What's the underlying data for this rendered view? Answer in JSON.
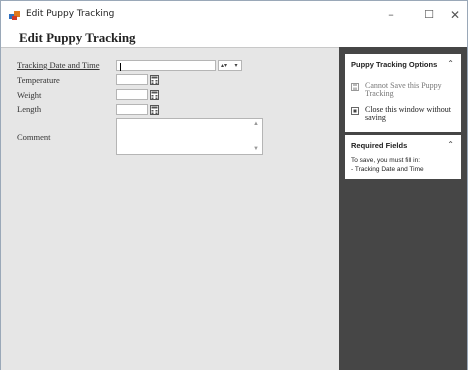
{
  "window": {
    "title": "Edit Puppy Tracking",
    "controls": {
      "minimize": "–",
      "maximize": "☐",
      "close": "✕"
    }
  },
  "form": {
    "title": "Edit Puppy Tracking",
    "fields": {
      "date": {
        "label": "Tracking Date and Time",
        "value": ""
      },
      "temperature": {
        "label": "Temperature",
        "value": ""
      },
      "weight": {
        "label": "Weight",
        "value": ""
      },
      "length": {
        "label": "Length",
        "value": ""
      },
      "comment": {
        "label": "Comment",
        "value": ""
      }
    }
  },
  "sidebar": {
    "options_panel": {
      "title": "Puppy Tracking Options",
      "items": [
        {
          "label": "Cannot Save this Puppy Tracking",
          "enabled": false,
          "icon": "save-icon"
        },
        {
          "label": "Close this window without saving",
          "enabled": true,
          "icon": "close-icon"
        }
      ]
    },
    "required_panel": {
      "title": "Required Fields",
      "intro": "To save, you must fill in:",
      "items": [
        "- Tracking Date and Time"
      ]
    },
    "chevron": "⌃"
  },
  "colors": {
    "form_bg": "#e6e6e6",
    "sidebar_bg": "#464646",
    "panel_bg": "#ffffff"
  }
}
